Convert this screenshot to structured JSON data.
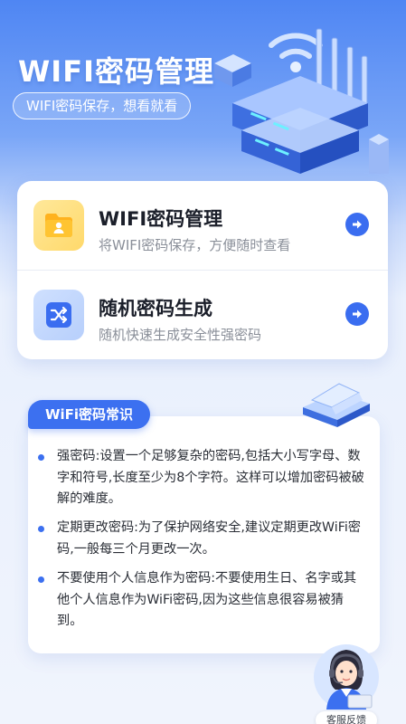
{
  "header": {
    "title": "WIFI密码管理",
    "subtitle": "WIFI密码保存，想看就看"
  },
  "features": [
    {
      "title": "WIFI密码管理",
      "description": "将WIFI密码保存，方便随时查看",
      "icon": "folder-user-icon",
      "accent": "#ffd96b"
    },
    {
      "title": "随机密码生成",
      "description": "随机快速生成安全性强密码",
      "icon": "shuffle-icon",
      "accent": "#b7cffb"
    }
  ],
  "tips": {
    "header": "WiFi密码常识",
    "items": [
      "强密码:设置一个足够复杂的密码,包括大小写字母、数字和符号,长度至少为8个字符。这样可以增加密码被破解的难度。",
      "定期更改密码:为了保护网络安全,建议定期更改WiFi密码,一般每三个月更改一次。",
      "不要使用个人信息作为密码:不要使用生日、名字或其他个人信息作为WiFi密码,因为这些信息很容易被猜到。"
    ]
  },
  "service": {
    "label": "客服反馈",
    "icon": "customer-service-avatar"
  },
  "colors": {
    "primary": "#3c70f0",
    "header_bg": "#4f86f3",
    "page_bg": "#f0f4fd"
  }
}
